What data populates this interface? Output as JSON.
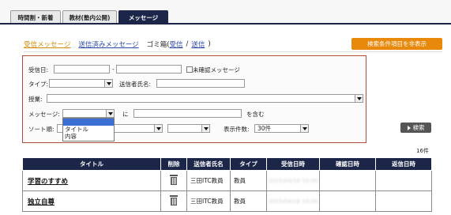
{
  "tabs": [
    {
      "label": "時間割・新着",
      "active": false
    },
    {
      "label": "教材(塾内公開)",
      "active": false
    },
    {
      "label": "メッセージ",
      "active": true
    }
  ],
  "subnav": {
    "received": "受信メッセージ",
    "sent": "送信済みメッセージ",
    "trash_label": "ゴミ箱(",
    "trash_received": "受信",
    "slash": "/",
    "trash_sent": "送信",
    "close_paren": ")"
  },
  "hide_conditions_button": "検索条件項目を非表示",
  "form": {
    "received_date_label": "受信日:",
    "date_from": "",
    "date_sep": "-",
    "date_to": "",
    "unconfirmed_label": "未確認メッセージ",
    "type_label": "タイプ:",
    "type_value": "",
    "sender_label": "送信者氏名:",
    "sender_value": "",
    "course_label": "授業:",
    "course_value": "",
    "message_label": "メッセージ:",
    "message_field_value": "",
    "ni_label": "に",
    "keyword_value": "",
    "contains_label": "を含む",
    "sort_label": "ソート順:",
    "sort_value1": "",
    "sort_value2": "",
    "sort_value3": "",
    "display_count_label": "表示件数:",
    "display_count_value": "30件",
    "dropdown_options": [
      "",
      "タイトル",
      "内容"
    ]
  },
  "search_button": "検索",
  "result_count": "16件",
  "table": {
    "headers": [
      "タイトル",
      "削除",
      "送信者氏名",
      "タイプ",
      "受信日時",
      "確認日時",
      "返信日時"
    ],
    "rows": [
      {
        "title": "学習のすすめ",
        "sender": "三田ITC教員",
        "type": "教員",
        "received": "2015/04/16 10:00",
        "confirmed": "",
        "replied": ""
      },
      {
        "title": "独立自尊",
        "sender": "三田ITC教員",
        "type": "教員",
        "received": "2015/04/16 10:00",
        "confirmed": "",
        "replied": ""
      }
    ]
  }
}
